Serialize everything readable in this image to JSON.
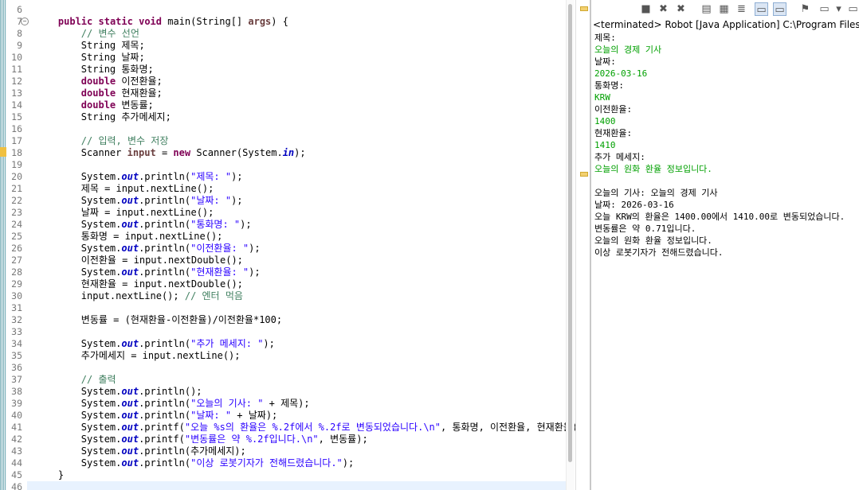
{
  "editor": {
    "lines": [
      {
        "n": "6",
        "segs": [
          {
            "t": ""
          }
        ]
      },
      {
        "n": "7",
        "fold": true,
        "segs": [
          {
            "t": "    "
          },
          {
            "t": "public",
            "c": "kw"
          },
          {
            "t": " "
          },
          {
            "t": "static",
            "c": "kw"
          },
          {
            "t": " "
          },
          {
            "t": "void",
            "c": "kw"
          },
          {
            "t": " main(String[] "
          },
          {
            "t": "args",
            "c": "iv"
          },
          {
            "t": ") {"
          }
        ]
      },
      {
        "n": "8",
        "segs": [
          {
            "t": "        "
          },
          {
            "t": "// 변수 선언",
            "c": "cm"
          }
        ]
      },
      {
        "n": "9",
        "segs": [
          {
            "t": "        String 제목;"
          }
        ]
      },
      {
        "n": "10",
        "segs": [
          {
            "t": "        String 날짜;"
          }
        ]
      },
      {
        "n": "11",
        "segs": [
          {
            "t": "        String 통화명;"
          }
        ]
      },
      {
        "n": "12",
        "segs": [
          {
            "t": "        "
          },
          {
            "t": "double",
            "c": "kw"
          },
          {
            "t": " 이전환율;"
          }
        ]
      },
      {
        "n": "13",
        "segs": [
          {
            "t": "        "
          },
          {
            "t": "double",
            "c": "kw"
          },
          {
            "t": " 현재환율;"
          }
        ]
      },
      {
        "n": "14",
        "segs": [
          {
            "t": "        "
          },
          {
            "t": "double",
            "c": "kw"
          },
          {
            "t": " 변동률;"
          }
        ]
      },
      {
        "n": "15",
        "segs": [
          {
            "t": "        String 추가메세지;"
          }
        ]
      },
      {
        "n": "16",
        "segs": [
          {
            "t": ""
          }
        ]
      },
      {
        "n": "17",
        "segs": [
          {
            "t": "        "
          },
          {
            "t": "// 입력, 변수 저장",
            "c": "cm"
          }
        ]
      },
      {
        "n": "18",
        "warn": true,
        "segs": [
          {
            "t": "        Scanner "
          },
          {
            "t": "input",
            "c": "iv"
          },
          {
            "t": " = "
          },
          {
            "t": "new",
            "c": "kw"
          },
          {
            "t": " Scanner(System."
          },
          {
            "t": "in",
            "c": "fld"
          },
          {
            "t": ");"
          }
        ]
      },
      {
        "n": "19",
        "segs": [
          {
            "t": ""
          }
        ]
      },
      {
        "n": "20",
        "segs": [
          {
            "t": "        System."
          },
          {
            "t": "out",
            "c": "fld"
          },
          {
            "t": ".println("
          },
          {
            "t": "\"제목: \"",
            "c": "st"
          },
          {
            "t": ");"
          }
        ]
      },
      {
        "n": "21",
        "segs": [
          {
            "t": "        제목 = input.nextLine();"
          }
        ]
      },
      {
        "n": "22",
        "segs": [
          {
            "t": "        System."
          },
          {
            "t": "out",
            "c": "fld"
          },
          {
            "t": ".println("
          },
          {
            "t": "\"날짜: \"",
            "c": "st"
          },
          {
            "t": ");"
          }
        ]
      },
      {
        "n": "23",
        "segs": [
          {
            "t": "        날짜 = input.nextLine();"
          }
        ]
      },
      {
        "n": "24",
        "segs": [
          {
            "t": "        System."
          },
          {
            "t": "out",
            "c": "fld"
          },
          {
            "t": ".println("
          },
          {
            "t": "\"통화명: \"",
            "c": "st"
          },
          {
            "t": ");"
          }
        ]
      },
      {
        "n": "25",
        "segs": [
          {
            "t": "        통화명 = input.nextLine();"
          }
        ]
      },
      {
        "n": "26",
        "segs": [
          {
            "t": "        System."
          },
          {
            "t": "out",
            "c": "fld"
          },
          {
            "t": ".println("
          },
          {
            "t": "\"이전환율: \"",
            "c": "st"
          },
          {
            "t": ");"
          }
        ]
      },
      {
        "n": "27",
        "segs": [
          {
            "t": "        이전환율 = input.nextDouble();"
          }
        ]
      },
      {
        "n": "28",
        "segs": [
          {
            "t": "        System."
          },
          {
            "t": "out",
            "c": "fld"
          },
          {
            "t": ".println("
          },
          {
            "t": "\"현재환율: \"",
            "c": "st"
          },
          {
            "t": ");"
          }
        ]
      },
      {
        "n": "29",
        "segs": [
          {
            "t": "        현재환율 = input.nextDouble();"
          }
        ]
      },
      {
        "n": "30",
        "segs": [
          {
            "t": "        input.nextLine(); "
          },
          {
            "t": "// 엔터 먹음",
            "c": "cm"
          }
        ]
      },
      {
        "n": "31",
        "segs": [
          {
            "t": ""
          }
        ]
      },
      {
        "n": "32",
        "segs": [
          {
            "t": "        변동률 = (현재환율-이전환율)/이전환율*100;"
          }
        ]
      },
      {
        "n": "33",
        "segs": [
          {
            "t": ""
          }
        ]
      },
      {
        "n": "34",
        "segs": [
          {
            "t": "        System."
          },
          {
            "t": "out",
            "c": "fld"
          },
          {
            "t": ".println("
          },
          {
            "t": "\"추가 메세지: \"",
            "c": "st"
          },
          {
            "t": ");"
          }
        ]
      },
      {
        "n": "35",
        "segs": [
          {
            "t": "        추가메세지 = input.nextLine();"
          }
        ]
      },
      {
        "n": "36",
        "segs": [
          {
            "t": ""
          }
        ]
      },
      {
        "n": "37",
        "segs": [
          {
            "t": "        "
          },
          {
            "t": "// 출력",
            "c": "cm"
          }
        ]
      },
      {
        "n": "38",
        "segs": [
          {
            "t": "        System."
          },
          {
            "t": "out",
            "c": "fld"
          },
          {
            "t": ".println();"
          }
        ]
      },
      {
        "n": "39",
        "segs": [
          {
            "t": "        System."
          },
          {
            "t": "out",
            "c": "fld"
          },
          {
            "t": ".println("
          },
          {
            "t": "\"오늘의 기사: \"",
            "c": "st"
          },
          {
            "t": " + 제목);"
          }
        ]
      },
      {
        "n": "40",
        "segs": [
          {
            "t": "        System."
          },
          {
            "t": "out",
            "c": "fld"
          },
          {
            "t": ".println("
          },
          {
            "t": "\"날짜: \"",
            "c": "st"
          },
          {
            "t": " + 날짜);"
          }
        ]
      },
      {
        "n": "41",
        "segs": [
          {
            "t": "        System."
          },
          {
            "t": "out",
            "c": "fld"
          },
          {
            "t": ".printf("
          },
          {
            "t": "\"오늘 %s의 환율은 %.2f에서 %.2f로 변동되었습니다.\\n\"",
            "c": "st"
          },
          {
            "t": ", 통화명, 이전환율, 현재환율);"
          }
        ]
      },
      {
        "n": "42",
        "segs": [
          {
            "t": "        System."
          },
          {
            "t": "out",
            "c": "fld"
          },
          {
            "t": ".printf("
          },
          {
            "t": "\"변동률은 약 %.2f입니다.\\n\"",
            "c": "st"
          },
          {
            "t": ", 변동률);"
          }
        ]
      },
      {
        "n": "43",
        "segs": [
          {
            "t": "        System."
          },
          {
            "t": "out",
            "c": "fld"
          },
          {
            "t": ".println(추가메세지);"
          }
        ]
      },
      {
        "n": "44",
        "segs": [
          {
            "t": "        System."
          },
          {
            "t": "out",
            "c": "fld"
          },
          {
            "t": ".println("
          },
          {
            "t": "\"이상 로봇기자가 전해드렸습니다.\"",
            "c": "st"
          },
          {
            "t": ");"
          }
        ]
      },
      {
        "n": "45",
        "segs": [
          {
            "t": "    }"
          }
        ]
      },
      {
        "n": "46",
        "current": true,
        "segs": [
          {
            "t": ""
          }
        ]
      }
    ]
  },
  "console": {
    "title": "<terminated> Robot [Java Application] C:\\Program Files\\Java\\",
    "toolbar_icons": [
      "terminate-icon",
      "remove-launch-icon",
      "remove-all-launches-icon",
      "clear-console-icon",
      "scroll-lock-icon",
      "word-wrap-icon",
      "show-on-stdout-icon",
      "show-on-stderr-icon",
      "pin-console-icon",
      "display-console-icon",
      "display-console-dropdown-icon",
      "open-console-icon"
    ],
    "output": [
      {
        "text": "제목:",
        "input": false
      },
      {
        "text": "오늘의 경제 기사",
        "input": true
      },
      {
        "text": "날짜:",
        "input": false
      },
      {
        "text": "2026-03-16",
        "input": true
      },
      {
        "text": "통화명:",
        "input": false
      },
      {
        "text": "KRW",
        "input": true
      },
      {
        "text": "이전환율:",
        "input": false
      },
      {
        "text": "1400",
        "input": true
      },
      {
        "text": "현재환율:",
        "input": false
      },
      {
        "text": "1410",
        "input": true
      },
      {
        "text": "추가 메세지:",
        "input": false
      },
      {
        "text": "오늘의 원화 환율 정보입니다.",
        "input": true
      },
      {
        "text": "",
        "input": false
      },
      {
        "text": "오늘의 기사: 오늘의 경제 기사",
        "input": false
      },
      {
        "text": "날짜: 2026-03-16",
        "input": false
      },
      {
        "text": "오늘 KRW의 환율은 1400.00에서 1410.00로 변동되었습니다.",
        "input": false
      },
      {
        "text": "변동률은 약 0.71입니다.",
        "input": false
      },
      {
        "text": "오늘의 원화 환율 정보입니다.",
        "input": false
      },
      {
        "text": "이상 로봇기자가 전해드렸습니다.",
        "input": false
      }
    ],
    "colors": {
      "input": "#00a000",
      "output": "#000000"
    }
  },
  "syntax_colors": {
    "keyword": "#7f0055",
    "comment": "#3f7f5f",
    "string": "#2a00ff",
    "field": "#0000c0"
  }
}
